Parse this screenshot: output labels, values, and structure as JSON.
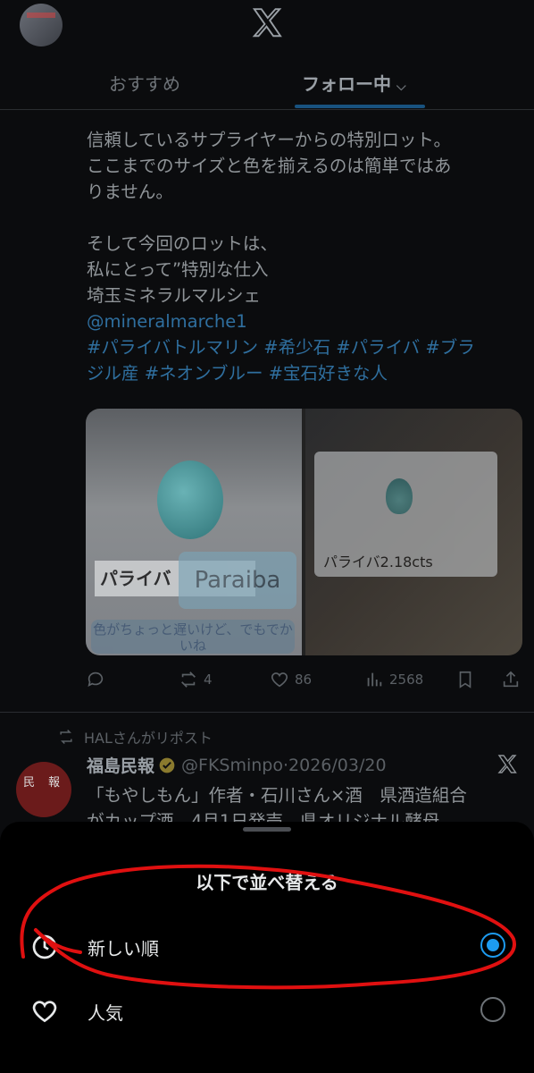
{
  "tabs": {
    "recommended": "おすすめ",
    "following": "フォロー中"
  },
  "tweet1": {
    "body_lines": [
      "信頼しているサプライヤーからの特別ロット。",
      "ここまでのサイズと色を揃えるのは簡単ではあ",
      "りません。",
      "",
      "そして今回のロットは、",
      "私にとって”特別な仕入",
      "埼玉ミネラルマルシェ"
    ],
    "mention": "@mineralmarche1",
    "hashtags_line1": "#パライバトルマリン #希少石 #パライバ #ブラ",
    "hashtags_line2": "ジル産 #ネオンブルー #宝石好きな人",
    "image1": {
      "label_jp": "パライバ",
      "label_en": "Paraiba",
      "caption": "色がちょっと遅いけど、でもでかいね"
    },
    "image2": {
      "label": "パライバ2.18cts"
    },
    "stats": {
      "reposts": "4",
      "likes": "86",
      "views": "2568"
    }
  },
  "tweet2": {
    "repost_by": "HALさんがリポスト",
    "avatar_text": [
      "民",
      "報"
    ],
    "name": "福島民報",
    "handle": "@FKSminpo",
    "date": "·2026/03/20",
    "text_line1": "「もやしもん」作者・石川さん×酒　県酒造組合",
    "text_line2": "がカップ酒　4月1日発売　県オリジナル酵母"
  },
  "sort_sheet": {
    "title": "以下で並べ替える",
    "options": [
      {
        "label": "新しい順",
        "selected": true
      },
      {
        "label": "人気",
        "selected": false
      }
    ]
  },
  "colors": {
    "accent": "#1d9bf0",
    "scribble": "#e01010"
  }
}
